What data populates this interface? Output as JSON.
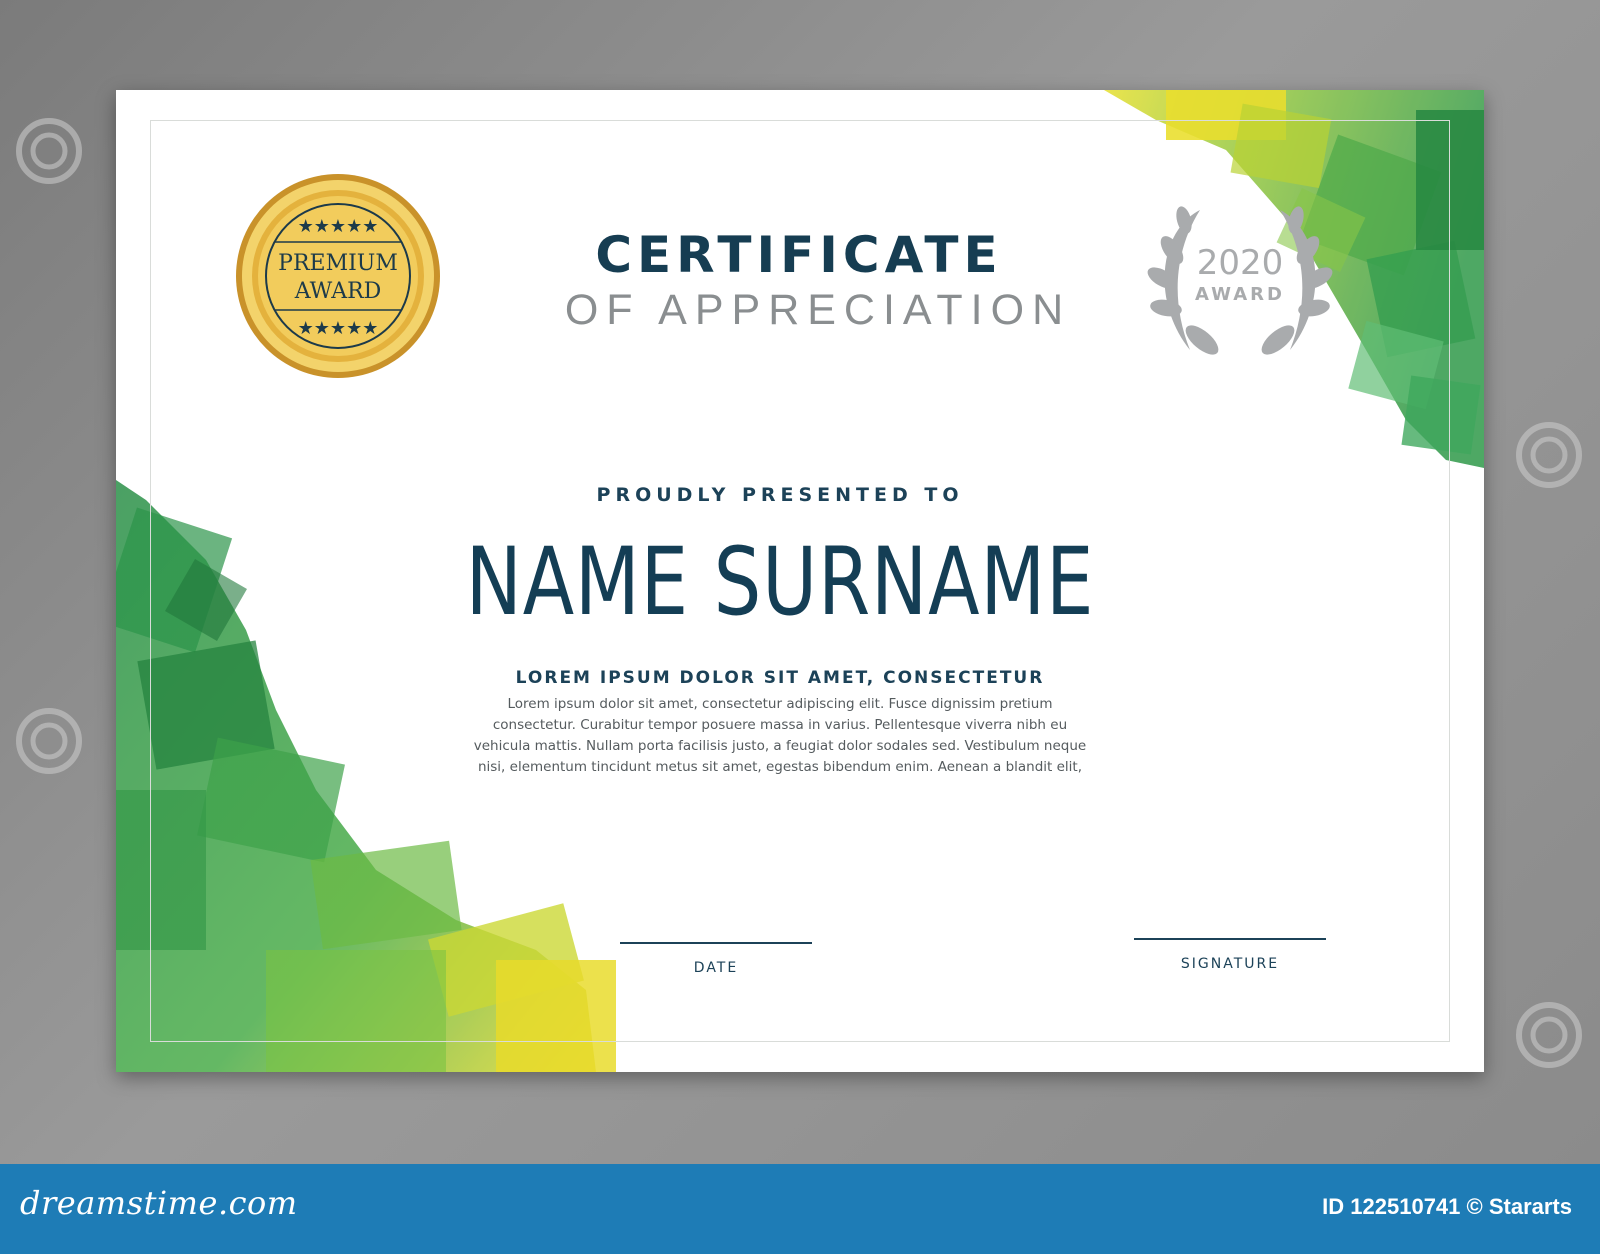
{
  "certificate": {
    "title": "CERTIFICATE",
    "subtitle": "OF APPRECIATION",
    "presented_to": "PROUDLY PRESENTED TO",
    "name": "NAME SURNAME",
    "lorem_heading": "LOREM IPSUM DOLOR SIT AMET, CONSECTETUR",
    "body_lines": [
      "Lorem ipsum dolor sit amet, consectetur adipiscing elit. Fusce dignissim pretium",
      "consectetur. Curabitur tempor posuere massa in varius. Pellentesque viverra nibh eu",
      "vehicula mattis. Nullam porta facilisis justo, a feugiat dolor sodales sed. Vestibulum neque",
      "nisi, elementum tincidunt metus sit amet, egestas bibendum enim. Aenean a blandit elit,"
    ],
    "date_label": "DATE",
    "signature_label": "SIGNATURE"
  },
  "seal": {
    "line1": "PREMIUM",
    "line2": "AWARD"
  },
  "laurel_badge": {
    "year": "2020",
    "label": "AWARD"
  },
  "footer": {
    "brand": "dreamstime.com",
    "id_text": "ID 122510741 © Stararts"
  },
  "colors": {
    "navy": "#163d52",
    "green": "#2e9a3e",
    "yellow": "#e0d21a",
    "gold": "#d9a72c",
    "footer_blue": "#1e7cb6"
  }
}
